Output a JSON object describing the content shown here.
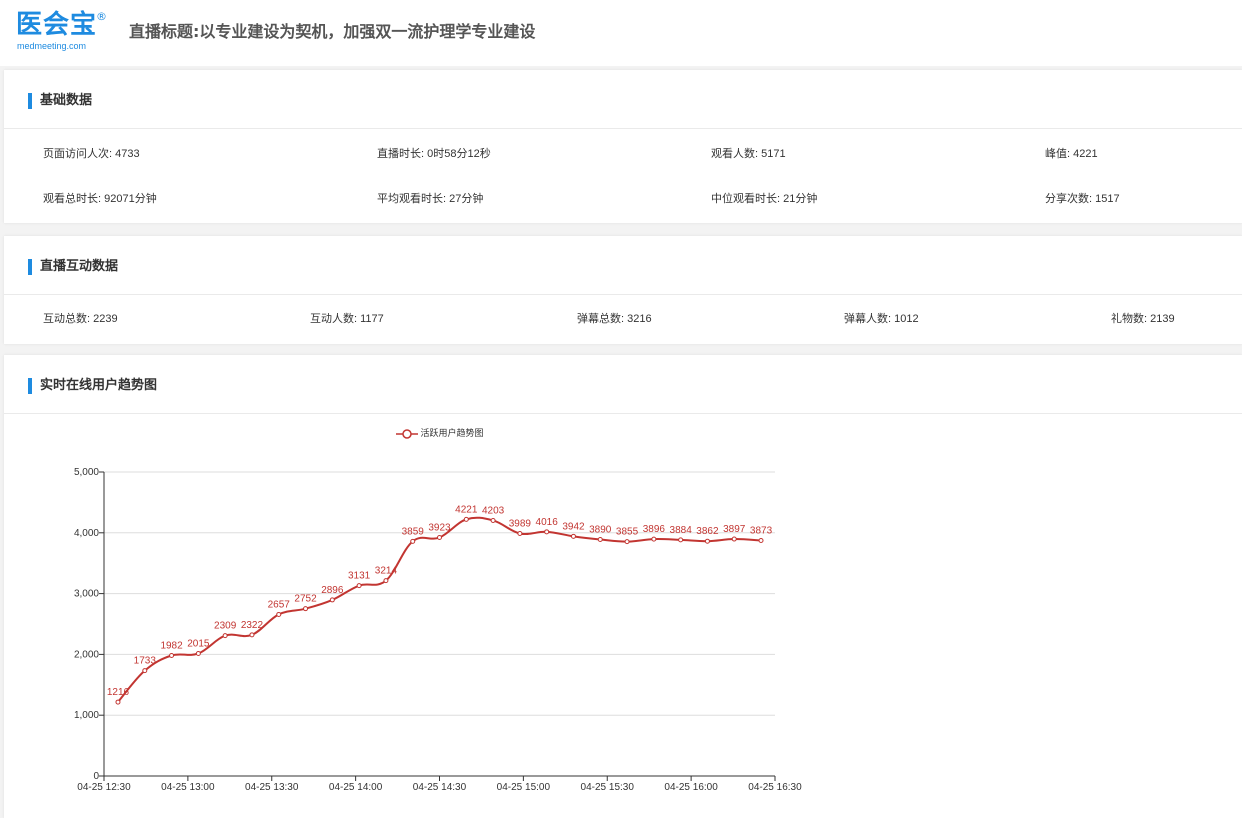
{
  "header": {
    "logo_text": "医会宝",
    "logo_reg": "®",
    "logo_url": "medmeeting.com",
    "title": "直播标题:以专业建设为契机，加强双一流护理学专业建设"
  },
  "basic": {
    "title": "基础数据",
    "stats": [
      "页面访问人次: 4733",
      "直播时长: 0时58分12秒",
      "观看人数: 5171",
      "峰值: 4221",
      "观看总时长: 92071分钟",
      "平均观看时长: 27分钟",
      "中位观看时长: 21分钟",
      "分享次数: 1517"
    ]
  },
  "interact": {
    "title": "直播互动数据",
    "stats": [
      "互动总数: 2239",
      "互动人数: 1177",
      "弹幕总数: 3216",
      "弹幕人数: 1012",
      "礼物数: 2139"
    ]
  },
  "trend": {
    "title": "实时在线用户趋势图"
  },
  "chart_data": {
    "type": "line",
    "legend": "活跃用户趋势图",
    "legend_position": "top-center",
    "color": "#c23531",
    "grid": true,
    "ylim": [
      0,
      5000
    ],
    "y_ticks": [
      "0",
      "1,000",
      "2,000",
      "3,000",
      "4,000",
      "5,000"
    ],
    "y_tick_values": [
      0,
      1000,
      2000,
      3000,
      4000,
      5000
    ],
    "x_tick_labels": [
      "04-25 12:30",
      "04-25 13:00",
      "04-25 13:30",
      "04-25 14:00",
      "04-25 14:30",
      "04-25 15:00",
      "04-25 15:30",
      "04-25 16:00",
      "04-25 16:30"
    ],
    "x": [
      "04-25 12:35",
      "04-25 12:40",
      "04-25 12:45",
      "04-25 12:50",
      "04-25 12:55",
      "04-25 13:00",
      "04-25 13:05",
      "04-25 13:10",
      "04-25 13:15",
      "04-25 13:20",
      "04-25 13:25",
      "04-25 13:30",
      "04-25 13:35",
      "04-25 13:40",
      "04-25 13:45",
      "04-25 13:50",
      "04-25 13:55",
      "04-25 14:00",
      "04-25 14:05",
      "04-25 14:10",
      "04-25 14:15",
      "04-25 14:20",
      "04-25 14:25",
      "04-25 14:30",
      "04-25 14:35",
      "04-25 14:40",
      "04-25 14:45",
      "04-25 14:50",
      "04-25 14:55",
      "04-25 15:00"
    ],
    "x_start": "04-25 12:30",
    "x_end": "04-25 16:30",
    "series": [
      {
        "name": "活跃用户趋势图",
        "times": [
          "04-25 12:35",
          "04-25 12:45",
          "04-25 12:55",
          "04-25 13:05",
          "04-25 13:15",
          "04-25 13:25",
          "04-25 13:35",
          "04-25 13:45",
          "04-25 13:55",
          "04-25 14:05",
          "04-25 14:15",
          "04-25 14:25",
          "04-25 14:35",
          "04-25 14:45",
          "04-25 14:55",
          "04-25 15:05",
          "04-25 15:15",
          "04-25 15:25",
          "04-25 15:35",
          "04-25 15:45",
          "04-25 15:55",
          "04-25 16:05",
          "04-25 16:15",
          "04-25 16:25"
        ],
        "values": [
          1216,
          1733,
          1982,
          2015,
          2309,
          2322,
          2657,
          2752,
          2896,
          3131,
          3214,
          3859,
          3923,
          4221,
          4203,
          3989,
          4016,
          3942,
          3890,
          3855,
          3896,
          3884,
          3862,
          3897,
          3873
        ]
      }
    ]
  }
}
